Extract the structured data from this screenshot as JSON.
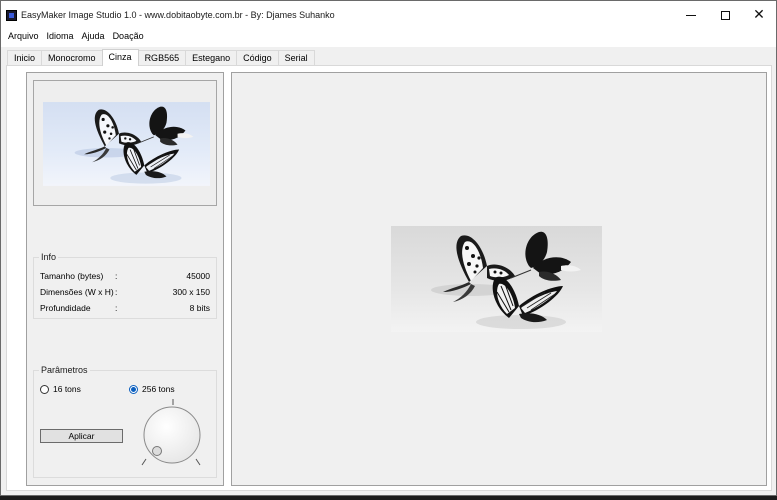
{
  "window": {
    "title": "EasyMaker Image Studio 1.0 - www.dobitaobyte.com.br - By: Djames Suhanko"
  },
  "menu": {
    "items": [
      "Arquivo",
      "Idioma",
      "Ajuda",
      "Doação"
    ]
  },
  "tabs": [
    "Inicio",
    "Monocromo",
    "Cinza",
    "RGB565",
    "Estegano",
    "Código",
    "Serial"
  ],
  "active_tab": "Cinza",
  "info": {
    "legend": "Info",
    "rows": [
      {
        "label": "Tamanho (bytes)",
        "colon": ":",
        "value": "45000"
      },
      {
        "label": "Dimensões (W x H)",
        "colon": ":",
        "value": "300 x 150"
      },
      {
        "label": "Profundidade",
        "colon": ":",
        "value": "8 bits"
      }
    ]
  },
  "params": {
    "legend": "Parâmetros",
    "option_16": "16 tons",
    "option_256": "256 tons",
    "selected": "256 tons",
    "apply_label": "Aplicar"
  },
  "colors": {
    "accent": "#0b5fbf",
    "thumb_background": "#dfe8f6",
    "preview_background": "#e4e4e4"
  }
}
